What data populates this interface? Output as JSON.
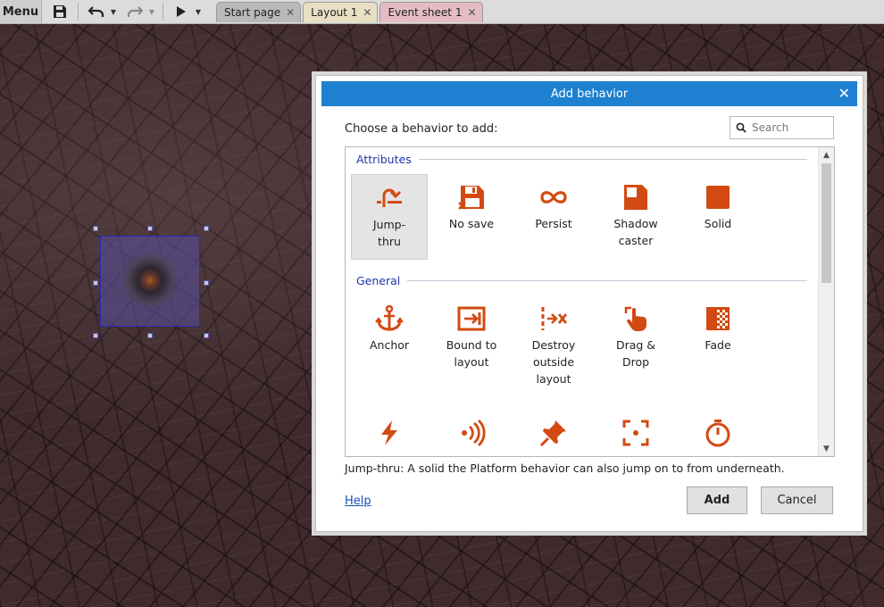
{
  "toolbar": {
    "menu_label": "Menu",
    "tabs": [
      {
        "label": "Start page"
      },
      {
        "label": "Layout 1"
      },
      {
        "label": "Event sheet 1"
      }
    ],
    "tab_close_glyph": "✕"
  },
  "dialog": {
    "title": "Add behavior",
    "close_glyph": "✕",
    "prompt": "Choose a behavior to add:",
    "search": {
      "placeholder": "Search",
      "value": ""
    },
    "accent_color": "#1e80d0",
    "icon_color": "#d24a12",
    "categories": [
      {
        "name": "Attributes",
        "items": [
          {
            "label": "Jump-thru",
            "icon": "jump-thru-icon",
            "selected": true
          },
          {
            "label": "No save",
            "icon": "no-save-icon"
          },
          {
            "label": "Persist",
            "icon": "persist-icon"
          },
          {
            "label": "Shadow caster",
            "icon": "shadow-caster-icon"
          },
          {
            "label": "Solid",
            "icon": "solid-icon"
          }
        ]
      },
      {
        "name": "General",
        "items": [
          {
            "label": "Anchor",
            "icon": "anchor-icon"
          },
          {
            "label": "Bound to layout",
            "icon": "bound-to-layout-icon"
          },
          {
            "label": "Destroy outside layout",
            "icon": "destroy-outside-layout-icon"
          },
          {
            "label": "Drag & Drop",
            "icon": "drag-drop-icon"
          },
          {
            "label": "Fade",
            "icon": "fade-icon"
          }
        ]
      }
    ],
    "partial_row_icons": [
      "flash-icon",
      "signal-icon",
      "pin-icon",
      "scroll-to-icon",
      "timer-icon"
    ],
    "description": "Jump-thru: A solid the Platform behavior can also jump on to from underneath.",
    "help_label": "Help",
    "add_label": "Add",
    "cancel_label": "Cancel"
  }
}
